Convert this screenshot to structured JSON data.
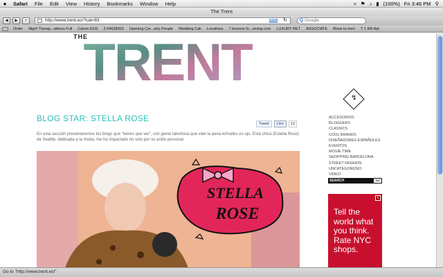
{
  "menubar": {
    "apple": "",
    "app": "Safari",
    "items": [
      "File",
      "Edit",
      "View",
      "History",
      "Bookmarks",
      "Window",
      "Help"
    ],
    "battery": "(100%)",
    "clock": "Fri 3:46 PM"
  },
  "window": {
    "title": "The Trent"
  },
  "toolbar": {
    "back": "◀",
    "forward": "▶",
    "add": "+",
    "url": "http://www.trent.es/?cat=83",
    "rss": "RSS",
    "reload": "↻",
    "search_placeholder": "Google"
  },
  "bookmarks": [
    "Order",
    "Night Therap...attress Full",
    "Canon EOS",
    "5 64628003",
    "Opening Cer...arty People",
    "Wedding Cak",
    "Locations",
    "7 lessons fo...oming.com",
    "LUXURY RET",
    "ASSOCIATE",
    "Move to tmm",
    "Y 1 RR Apt"
  ],
  "site": {
    "logo_the": "THE",
    "logo_word": "TRENT",
    "post_title": "BLOG STAR: STELLA ROSE",
    "tweet_label": "Tweet",
    "like_label": "Like",
    "like_count": "13",
    "intro": "En esta sección presentaremos los blogs que \"tienes que ver\", con gente talentosa que vale la pena echarles un ojo. Esta chica (Estella Rose) de Seattle, dedicada a la moda, me ha impactado no solo por su estilo personal.",
    "hero_line1": "STELLA",
    "hero_line2": "ROSE",
    "categories": [
      "ACCESORIOS",
      "BLOGGERS",
      "CLASSICS",
      "COOL BRANDS",
      "DISEÑADORES ESPAÑOLES",
      "EVENTOS",
      "MOVIE TIME",
      "SHOPPING BARCELONA",
      "STREET FASHION",
      "UNCATEGORIZED",
      "VIDEO"
    ],
    "search_label": "SEARCH",
    "search_go": "GO",
    "ad_text": [
      "Tell the",
      "world what",
      "you think.",
      "Rate NYC",
      "shops."
    ],
    "ad_close": "x"
  },
  "statusbar": {
    "text": "Go to \"http://www.trent.es/\""
  },
  "colors": {
    "accent": "#2cbfb8",
    "ad_red": "#c8102e"
  }
}
